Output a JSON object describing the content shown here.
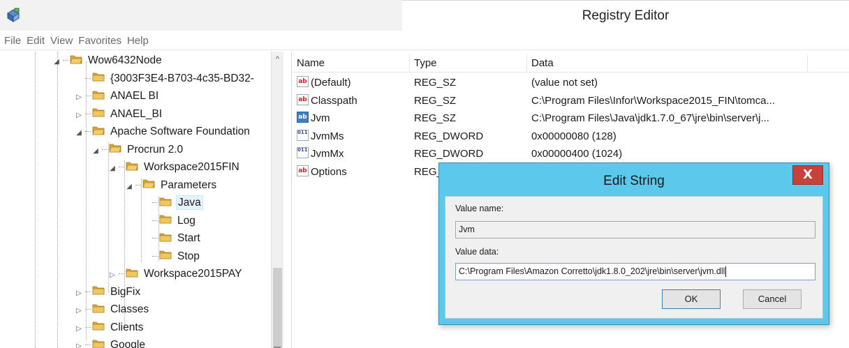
{
  "window": {
    "title": "Registry Editor"
  },
  "menu": [
    "File",
    "Edit",
    "View",
    "Favorites",
    "Help"
  ],
  "tree": {
    "items": [
      {
        "label": "Wow6432Node",
        "expander": "◢"
      },
      {
        "label": "{3003F3E4-B703-4c35-BD32-",
        "expander": ""
      },
      {
        "label": "ANAEL BI",
        "expander": "▷"
      },
      {
        "label": "ANAEL_BI",
        "expander": "▷"
      },
      {
        "label": "Apache Software Foundation",
        "expander": "◢"
      },
      {
        "label": "Procrun 2.0",
        "expander": "◢"
      },
      {
        "label": "Workspace2015FIN",
        "expander": "◢"
      },
      {
        "label": "Parameters",
        "expander": "◢"
      },
      {
        "label": "Java",
        "expander": ""
      },
      {
        "label": "Log",
        "expander": ""
      },
      {
        "label": "Start",
        "expander": ""
      },
      {
        "label": "Stop",
        "expander": ""
      },
      {
        "label": "Workspace2015PAY",
        "expander": "▷"
      },
      {
        "label": "BigFix",
        "expander": "▷"
      },
      {
        "label": "Classes",
        "expander": "▷"
      },
      {
        "label": "Clients",
        "expander": "▷"
      },
      {
        "label": "Google",
        "expander": "▷"
      }
    ],
    "scroll_up": "^"
  },
  "list": {
    "columns": [
      "Name",
      "Type",
      "Data"
    ],
    "rows": [
      {
        "icon": "ab",
        "name": "(Default)",
        "type": "REG_SZ",
        "data": "(value not set)"
      },
      {
        "icon": "ab",
        "name": "Classpath",
        "type": "REG_SZ",
        "data": "C:\\Program Files\\Infor\\Workspace2015_FIN\\tomca..."
      },
      {
        "icon": "ab",
        "name": "Jvm",
        "type": "REG_SZ",
        "data": "C:\\Program Files\\Java\\jdk1.7.0_67\\jre\\bin\\server\\j..."
      },
      {
        "icon": "dword",
        "name": "JvmMs",
        "type": "REG_DWORD",
        "data": "0x00000080 (128)"
      },
      {
        "icon": "dword",
        "name": "JvmMx",
        "type": "REG_DWORD",
        "data": "0x00000400 (1024)"
      },
      {
        "icon": "ab",
        "name": "Options",
        "type": "REG_",
        "data": ""
      }
    ]
  },
  "dialog": {
    "title": "Edit String",
    "close_label": "X",
    "value_name_label": "Value name:",
    "value_name": "Jvm",
    "value_data_label": "Value data:",
    "value_data": "C:\\Program Files\\Amazon Corretto\\jdk1.8.0_202\\jre\\bin\\server\\jvm.dll",
    "ok_label": "OK",
    "cancel_label": "Cancel"
  },
  "icons": {
    "value_string": "ab",
    "value_dword": "011 110"
  },
  "colors": {
    "dialog_frame": "#5bc8ec",
    "close_button": "#c7423a",
    "folder": "#e8b84a"
  }
}
